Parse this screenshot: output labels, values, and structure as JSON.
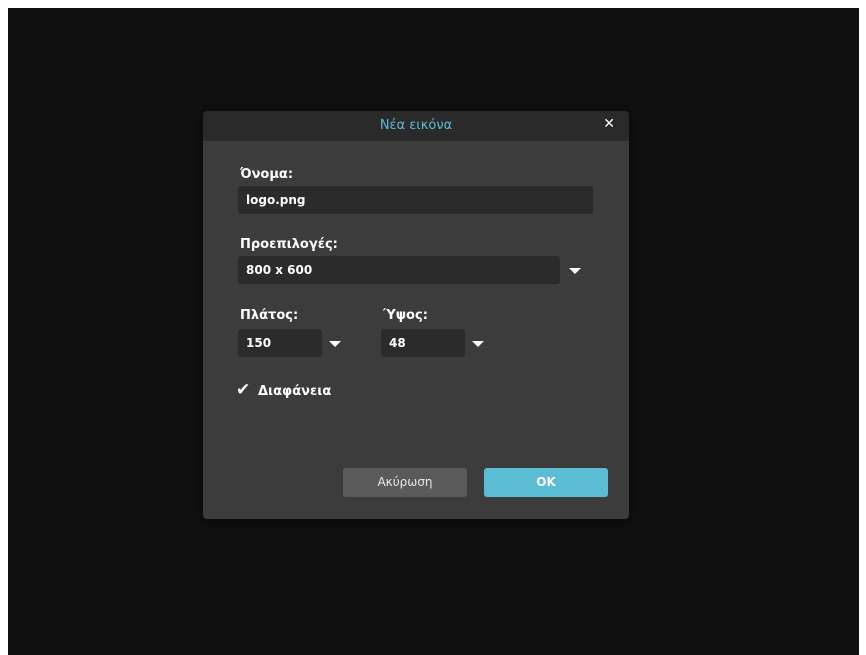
{
  "dialog": {
    "title": "Νέα εικόνα",
    "close_icon": "close-icon"
  },
  "name_field": {
    "label": "Όνομα:",
    "value": "logo.png"
  },
  "presets": {
    "label": "Προεπιλογές:",
    "value": "800 x 600"
  },
  "width": {
    "label": "Πλάτος:",
    "value": "150"
  },
  "height": {
    "label": "Ύψος:",
    "value": "48"
  },
  "transparency": {
    "checked": true,
    "label": "Διαφάνεια"
  },
  "buttons": {
    "cancel": "Ακύρωση",
    "ok": "OK"
  },
  "colors": {
    "accent": "#5bbcd6",
    "dialog_bg": "#3c3c3c",
    "field_bg": "#2b2b2b",
    "backdrop": "#101010"
  }
}
